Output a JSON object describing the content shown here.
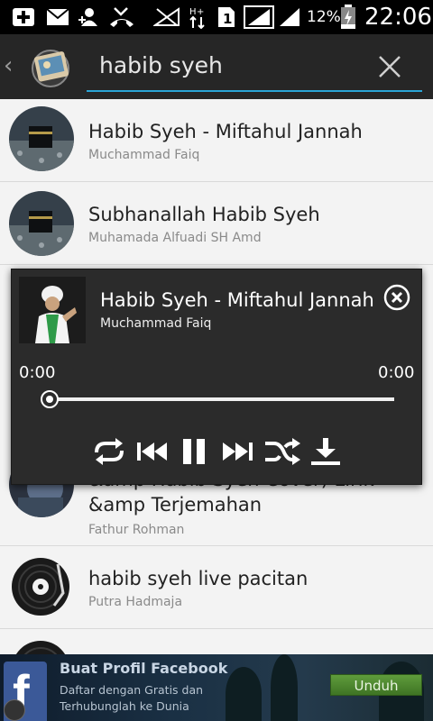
{
  "statusbar": {
    "battery_percent": "12%",
    "time": "22:06",
    "icons": [
      "add-icon",
      "mail-icon",
      "add-contact-icon",
      "missed-call-icon",
      "no-signal-icon",
      "data-arrows-icon",
      "sim-1-icon",
      "signal-icon",
      "signal-icon",
      "battery-charging-icon"
    ]
  },
  "search": {
    "query": "habib syeh"
  },
  "results": [
    {
      "title": "Habib Syeh - Miftahul Jannah",
      "artist": "Muchammad Faiq"
    },
    {
      "title": "Subhanallah Habib Syeh",
      "artist": "Muhamada Alfuadi SH Amd"
    },
    {
      "title_line1": "&amp Habib Syeh Cover) Lirik",
      "title_line2": "&amp Terjemahan",
      "artist": "Fathur Rohman"
    },
    {
      "title": "habib syeh live pacitan",
      "artist": "Putra Hadmaja"
    }
  ],
  "player": {
    "title": "Habib Syeh - Miftahul Jannah",
    "artist": "Muchammad Faiq",
    "elapsed": "0:00",
    "duration": "0:00",
    "progress": 0.0,
    "controls": [
      "repeat-icon",
      "previous-icon",
      "pause-icon",
      "next-icon",
      "shuffle-icon",
      "download-icon"
    ]
  },
  "ad": {
    "title": "Buat Profil Facebook",
    "line1": "Daftar dengan Gratis dan",
    "line2": "Terhubunglah ke Dunia",
    "button": "Unduh",
    "logo_letter": "f"
  },
  "colors": {
    "accent": "#2aa4d6",
    "actionbar": "#262626",
    "player_bg": "#2b2b2b",
    "facebook_blue": "#3b5998",
    "ad_button": "#4f8a30"
  }
}
